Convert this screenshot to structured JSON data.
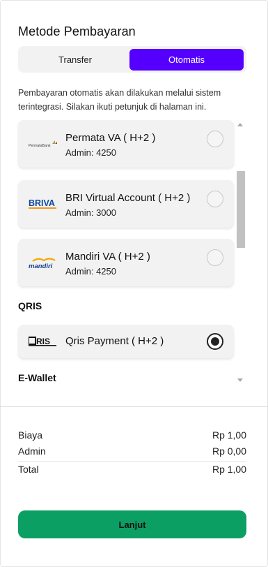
{
  "header": {
    "title": "Metode Pembayaran"
  },
  "tabs": {
    "transfer": "Transfer",
    "otomatis": "Otomatis",
    "active": "otomatis"
  },
  "description": "Pembayaran otomatis akan dilakukan melalui sistem terintegrasi. Silakan ikuti petunjuk di halaman ini.",
  "virtual_accounts": [
    {
      "name": "Permata VA ( H+2 )",
      "admin": "Admin: 4250",
      "logo": "permata-bank-logo",
      "logo_text": "PermataBank",
      "selected": false
    },
    {
      "name": "BRI Virtual Account ( H+2 )",
      "admin": "Admin: 3000",
      "logo": "briva-logo",
      "logo_text": "BRIVA",
      "selected": false
    },
    {
      "name": "Mandiri VA ( H+2 )",
      "admin": "Admin: 4250",
      "logo": "mandiri-logo",
      "logo_text": "mandiri",
      "selected": false
    }
  ],
  "qris": {
    "section_label": "QRIS",
    "items": [
      {
        "name": "Qris Payment ( H+2 )",
        "logo": "qris-logo",
        "logo_text": "QRIS",
        "selected": true
      }
    ]
  },
  "ewallet": {
    "section_label": "E-Wallet"
  },
  "summary": {
    "rows": [
      {
        "label": "Biaya",
        "value": "Rp 1,00"
      },
      {
        "label": "Admin",
        "value": "Rp 0,00"
      },
      {
        "label": "Total",
        "value": "Rp 1,00"
      }
    ]
  },
  "actions": {
    "continue_label": "Lanjut"
  },
  "colors": {
    "accent": "#5500ff",
    "continue_button": "#0b9f64",
    "card_bg": "#f2f2f2"
  }
}
